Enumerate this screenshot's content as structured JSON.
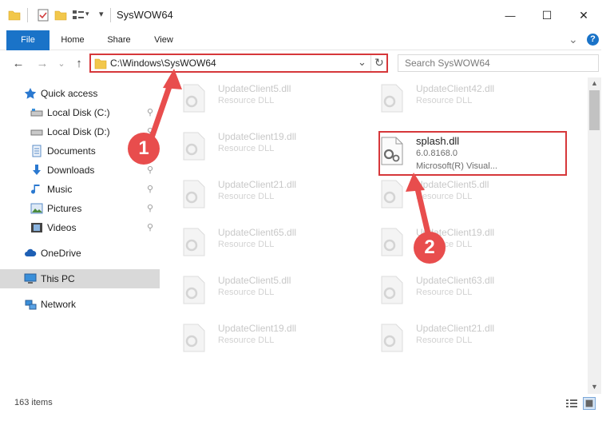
{
  "window": {
    "title": "SysWOW64",
    "minimize_glyph": "—",
    "maximize_glyph": "☐",
    "close_glyph": "✕"
  },
  "ribbon": {
    "tabs": [
      {
        "label": "File"
      },
      {
        "label": "Home"
      },
      {
        "label": "Share"
      },
      {
        "label": "View"
      }
    ],
    "expand_glyph": "⌄",
    "help_glyph": "?"
  },
  "address": {
    "path": "C:\\Windows\\SysWOW64",
    "refresh_glyph": "↻",
    "dropdown_glyph": "⌄"
  },
  "search": {
    "placeholder": "Search SysWOW64",
    "search_glyph": "⌕"
  },
  "nav": {
    "back_glyph": "←",
    "forward_glyph": "→",
    "recent_glyph": "⌄",
    "up_glyph": "↑"
  },
  "sidebar": {
    "items": [
      {
        "label": "Quick access",
        "icon": "star-icon",
        "pinned": false
      },
      {
        "label": "Local Disk (C:)",
        "icon": "drive-icon",
        "pinned": true
      },
      {
        "label": "Local Disk (D:)",
        "icon": "drive-icon",
        "pinned": true
      },
      {
        "label": "Documents",
        "icon": "documents-icon",
        "pinned": true
      },
      {
        "label": "Downloads",
        "icon": "download-icon",
        "pinned": true
      },
      {
        "label": "Music",
        "icon": "music-icon",
        "pinned": true
      },
      {
        "label": "Pictures",
        "icon": "pictures-icon",
        "pinned": true
      },
      {
        "label": "Videos",
        "icon": "videos-icon",
        "pinned": true
      },
      {
        "label": "OneDrive",
        "icon": "cloud-icon",
        "pinned": false
      },
      {
        "label": "This PC",
        "icon": "computer-icon",
        "pinned": false,
        "selected": true
      },
      {
        "label": "Network",
        "icon": "network-icon",
        "pinned": false
      }
    ],
    "pin_glyph": "📌"
  },
  "files": {
    "left_column": [
      {
        "name": "UpdateClient5.dll",
        "desc": "Resource DLL"
      },
      {
        "name": "UpdateClient19.dll",
        "desc": "Resource DLL"
      },
      {
        "name": "UpdateClient21.dll",
        "desc": "Resource DLL"
      },
      {
        "name": "UpdateClient65.dll",
        "desc": "Resource DLL"
      },
      {
        "name": "UpdateClient5.dll",
        "desc": "Resource DLL"
      },
      {
        "name": "UpdateClient19.dll",
        "desc": "Resource DLL"
      }
    ],
    "right_column": [
      {
        "name": "UpdateClient42.dll",
        "desc": "Resource DLL"
      },
      {
        "name": "splash.dll",
        "version": "6.0.8168.0",
        "desc": "Microsoft(R) Visual...",
        "highlighted": true
      },
      {
        "name": "UpdateClient5.dll",
        "desc": "Resource DLL"
      },
      {
        "name": "UpdateClient19.dll",
        "desc": "Resource DLL"
      },
      {
        "name": "UpdateClient63.dll",
        "desc": "Resource DLL"
      },
      {
        "name": "UpdateClient21.dll",
        "desc": "Resource DLL"
      }
    ]
  },
  "annotations": {
    "step1": "1",
    "step2": "2"
  },
  "status": {
    "item_count": "163 items"
  },
  "colors": {
    "accent": "#1a73c8",
    "annotation_red": "#e84d4d",
    "highlight_border": "#d6373a",
    "selected_bg": "#d9d9d9"
  }
}
